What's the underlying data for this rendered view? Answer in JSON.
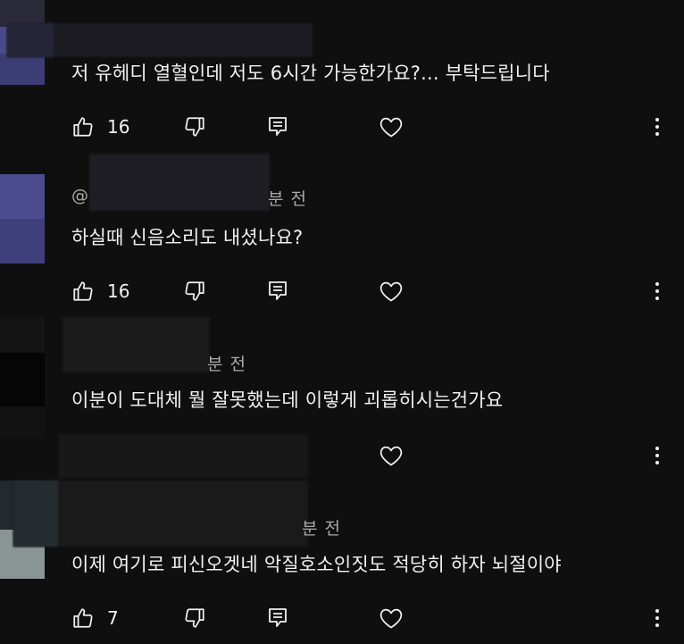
{
  "comments": [
    {
      "text": "저 유헤디 열혈인데 저도 6시간 가능한가요?... 부탁드립니다",
      "meta": "",
      "likes": "16"
    },
    {
      "text": "하실때 신음소리도 내셨나요?",
      "meta_prefix": "@",
      "meta": "분 전",
      "likes": "16"
    },
    {
      "text": "이분이 도대체 뭘 잘못했는데 이렇게 괴롭히시는건가요",
      "meta": "분 전",
      "likes": ""
    },
    {
      "text": "이제 여기로 피신오겟네 악질호소인짓도 적당히 하자 뇌절이야",
      "meta": "분 전",
      "likes": "7"
    }
  ],
  "icons": {
    "like": "thumbs-up-icon",
    "dislike": "thumbs-down-icon",
    "reply": "reply-icon",
    "heart": "heart-icon",
    "more": "more-vertical-icon"
  },
  "colors": {
    "background": "#0f0f0f",
    "text": "#f1f1f1",
    "meta": "#aaaaaa"
  }
}
